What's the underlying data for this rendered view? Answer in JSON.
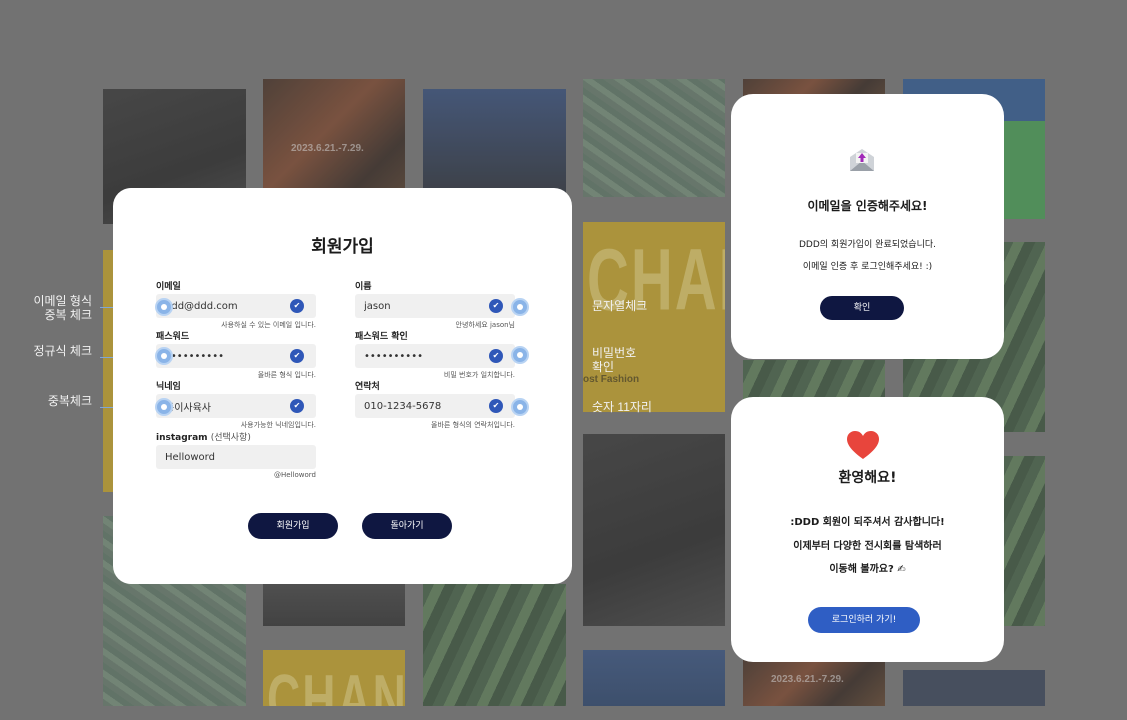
{
  "background": {
    "poster_date": "2023.6.21.-7.29.",
    "poster_word": "CHANG I",
    "poster_caption": "ost Fashion"
  },
  "annotations": {
    "left": [
      "이메일 형식\n중복 체크",
      "정규식 체크",
      "중복체크"
    ],
    "right": [
      "문자열체크",
      "비밀번호\n확인",
      "숫자 11자리"
    ]
  },
  "signup": {
    "title": "회원가입",
    "fields": {
      "email": {
        "label": "이메일",
        "value": "ddd@ddd.com",
        "hint": "사용하실 수 있는 이메일 입니다."
      },
      "name": {
        "label": "이름",
        "value": "jason",
        "hint": "안녕하세요 jason님"
      },
      "password": {
        "label": "패스워드",
        "value": "••••••••••",
        "hint": "올바른 형식 입니다."
      },
      "password_confirm": {
        "label": "패스워드 확인",
        "value": "••••••••••",
        "hint": "비밀 번호가 일치합니다."
      },
      "nickname": {
        "label": "닉네임",
        "value": "동이사육사",
        "hint": "사용가능한 닉네임입니다."
      },
      "phone": {
        "label": "연락처",
        "value": "010-1234-5678",
        "hint": "올바른 형식의 연락처입니다."
      },
      "instagram": {
        "label": "instagram",
        "label_extra": "(선택사항)",
        "value": "Helloword",
        "hint": "@Helloword"
      }
    },
    "buttons": {
      "submit": "회원가입",
      "back": "돌아가기"
    }
  },
  "verify_card": {
    "icon": "envelope-upload-icon",
    "title": "이메일을 인증해주세요!",
    "line1": "DDD의 회원가입이 완료되었습니다.",
    "line2": "이메일 인증 후 로그인해주세요! :)",
    "button": "확인"
  },
  "welcome_card": {
    "icon": "heart-icon",
    "title": "환영해요!",
    "line1": ":DDD 회원이 되주셔서 감사합니다!",
    "line2": "이제부터 다양한 전시회를 탐색하러",
    "line3": "이동해 볼까요?",
    "emoji": "✍",
    "button": "로그인하러 가기!"
  },
  "colors": {
    "navy": "#0f1741",
    "blue": "#2f5ec4",
    "check": "#2f57b8",
    "heart": "#e8453c"
  }
}
